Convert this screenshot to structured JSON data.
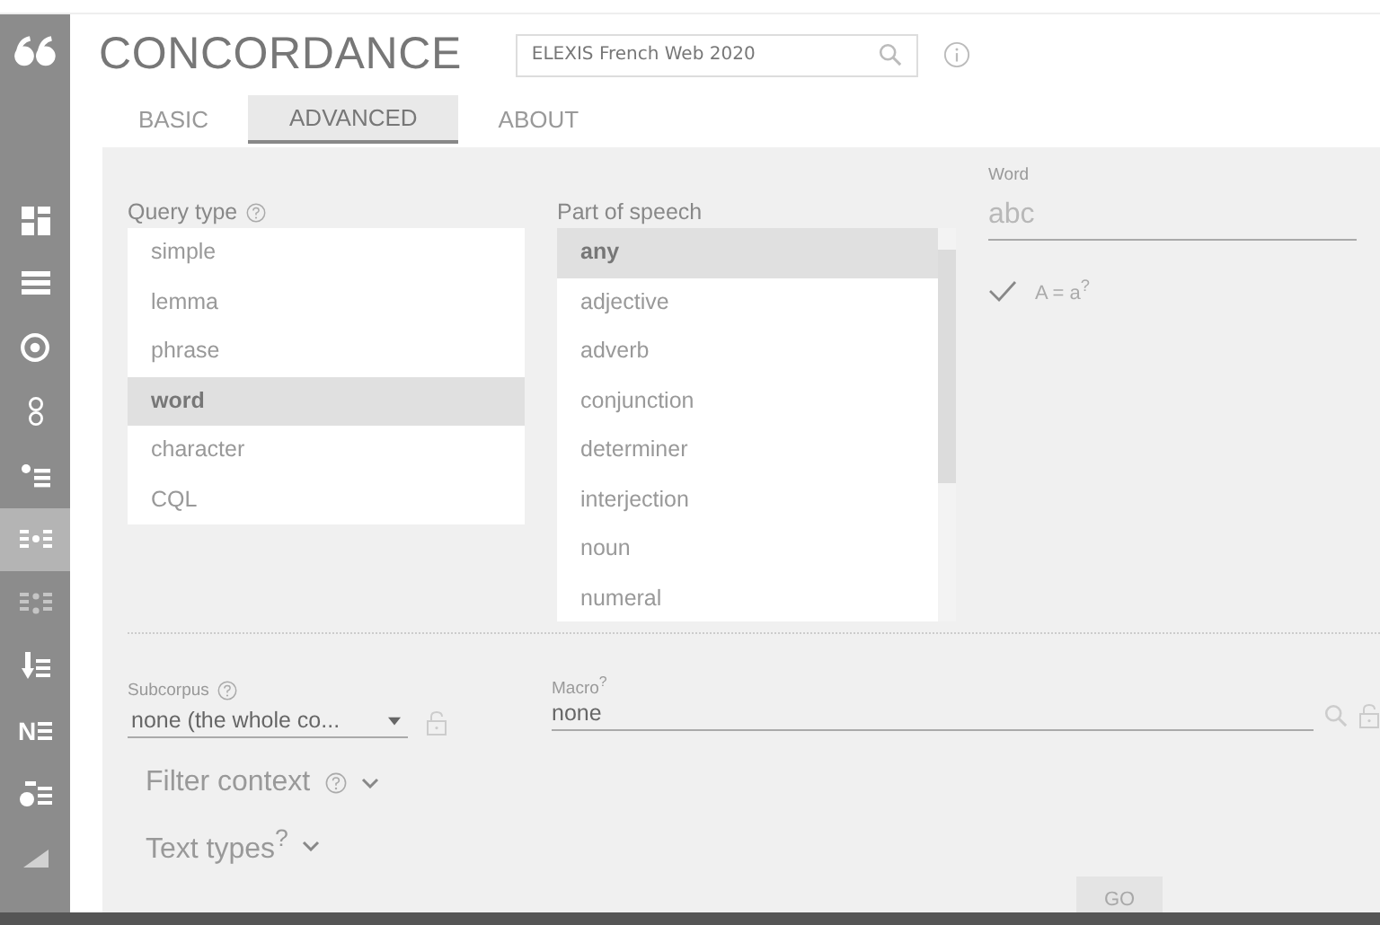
{
  "sidebar": {
    "items": [
      {
        "kind": "tiles",
        "selected": false
      },
      {
        "kind": "list",
        "selected": false
      },
      {
        "kind": "target",
        "selected": false
      },
      {
        "kind": "pair",
        "selected": false
      },
      {
        "kind": "bullets",
        "selected": false
      },
      {
        "kind": "concordance",
        "selected": true
      },
      {
        "kind": "parallel",
        "selected": false
      },
      {
        "kind": "sort",
        "selected": false
      },
      {
        "kind": "letter",
        "glyph": "N",
        "selected": false
      },
      {
        "kind": "keyword",
        "selected": false
      },
      {
        "kind": "chart",
        "selected": false
      }
    ]
  },
  "header": {
    "title": "CONCORDANCE",
    "corpus": "ELEXIS French Web 2020"
  },
  "tabs": [
    {
      "label": "BASIC",
      "selected": false
    },
    {
      "label": "ADVANCED",
      "selected": true
    },
    {
      "label": "ABOUT",
      "selected": false
    }
  ],
  "query_type": {
    "label": "Query type",
    "options": [
      {
        "label": "simple",
        "selected": false
      },
      {
        "label": "lemma",
        "selected": false
      },
      {
        "label": "phrase",
        "selected": false
      },
      {
        "label": "word",
        "selected": true
      },
      {
        "label": "character",
        "selected": false
      },
      {
        "label": "CQL",
        "selected": false
      }
    ]
  },
  "part_of_speech": {
    "label": "Part of speech",
    "options": [
      {
        "label": "any",
        "selected": true
      },
      {
        "label": "adjective",
        "selected": false
      },
      {
        "label": "adverb",
        "selected": false
      },
      {
        "label": "conjunction",
        "selected": false
      },
      {
        "label": "determiner",
        "selected": false
      },
      {
        "label": "interjection",
        "selected": false
      },
      {
        "label": "noun",
        "selected": false
      },
      {
        "label": "numeral",
        "selected": false
      }
    ]
  },
  "word": {
    "label": "Word",
    "placeholder": "abc",
    "match_case": {
      "label": "A = a$^{?}$",
      "checked": true
    }
  },
  "subcorpus": {
    "label": "Subcorpus",
    "value": "none (the whole co..."
  },
  "macro": {
    "label": "Macro$^{?}$",
    "value": "none"
  },
  "sections": [
    {
      "label": "Filter context",
      "help": true,
      "expanded": false
    },
    {
      "label": "Text types$^{?}$",
      "help": false,
      "expanded": false
    }
  ],
  "go_button": "GO"
}
